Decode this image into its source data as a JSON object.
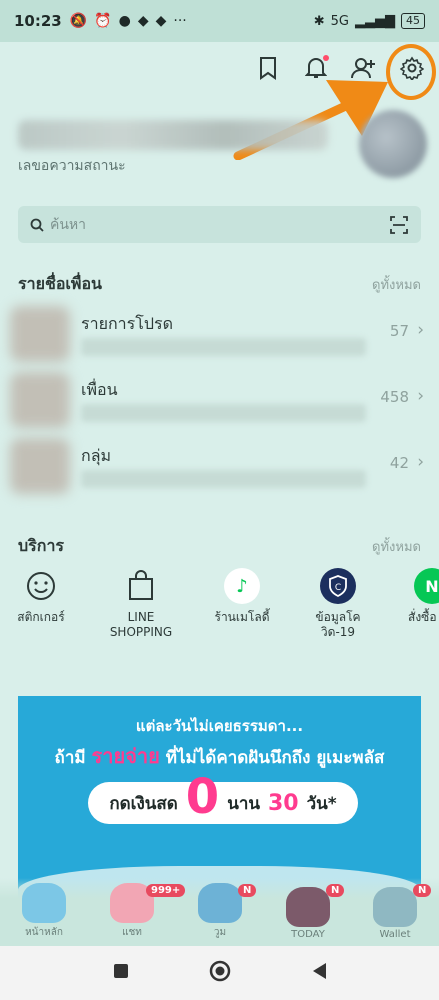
{
  "status_bar": {
    "time": "10:23",
    "network": "5G",
    "battery": "45"
  },
  "profile": {
    "status_message": "เลขอความสถานะ"
  },
  "search": {
    "placeholder": "ค้นหา"
  },
  "friends": {
    "title": "รายชื่อเพื่อน",
    "see_all": "ดูทั้งหมด",
    "rows": [
      {
        "label": "รายการโปรด",
        "count": "57"
      },
      {
        "label": "เพื่อน",
        "count": "458"
      },
      {
        "label": "กลุ่ม",
        "count": "42"
      }
    ]
  },
  "services": {
    "title": "บริการ",
    "see_all": "ดูทั้งหมด",
    "items": [
      {
        "label": "สติกเกอร์",
        "icon": "smiley-icon"
      },
      {
        "label": "LINE\nSHOPPING",
        "icon": "shopping-bag-icon"
      },
      {
        "label": "ร้านเมโลดี้",
        "icon": "melody-icon"
      },
      {
        "label": "ข้อมูลโค\nวิด-19",
        "icon": "covid-shield-icon"
      },
      {
        "label": "สั่งซื้อ",
        "icon": "n-icon"
      }
    ]
  },
  "banner": {
    "line1": "แต่ละวันไม่เคยธรรมดา...",
    "line2_a": "ถ้ามี",
    "line2_b": "รายจ่าย",
    "line2_c": "ที่ไม่ได้คาดฝันนึกถึง",
    "line2_d": "ยูเมะพลัส",
    "pill_a": "กดเงินสด",
    "pill_zero": "0",
    "pill_b": "นาน",
    "pill_thirty": "30",
    "pill_c": "วัน*"
  },
  "bottom_nav": {
    "items": [
      {
        "label": "หน้าหลัก",
        "badge": ""
      },
      {
        "label": "แชท",
        "badge": "999+"
      },
      {
        "label": "วูม",
        "badge": "N"
      },
      {
        "label": "TODAY",
        "badge": "N"
      },
      {
        "label": "Wallet",
        "badge": "N"
      }
    ]
  },
  "colors": {
    "background": "#d9efea",
    "highlight": "#f08a16",
    "accent_green": "#06c755",
    "badge": "#e84a5f",
    "banner": "#27a9d8"
  }
}
